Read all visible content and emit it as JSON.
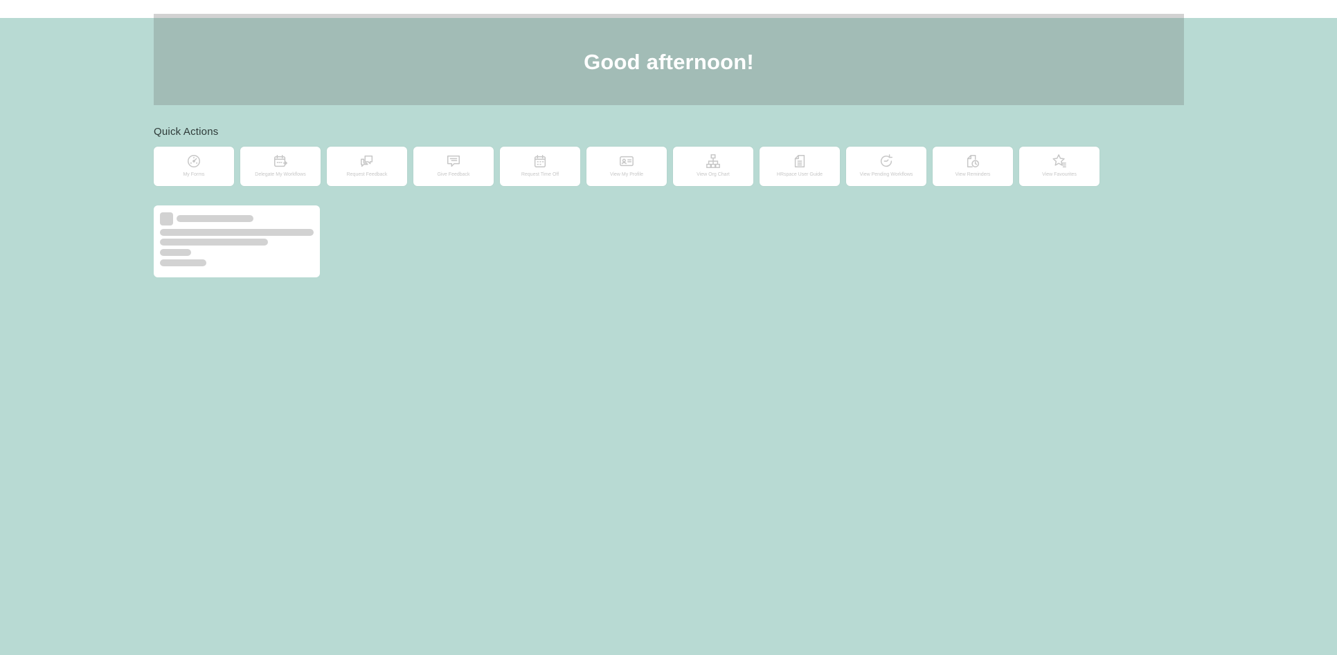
{
  "hero": {
    "title": "Good afternoon!"
  },
  "quick_actions": {
    "title": "Quick Actions",
    "items": [
      {
        "label": "My Forms",
        "icon": "gauge-icon"
      },
      {
        "label": "Delegate My Workflows",
        "icon": "calendar-arrow-icon"
      },
      {
        "label": "Request Feedback",
        "icon": "chat-bubbles-icon"
      },
      {
        "label": "Give Feedback",
        "icon": "chat-lines-icon"
      },
      {
        "label": "Request Time Off",
        "icon": "calendar-icon"
      },
      {
        "label": "View My Profile",
        "icon": "id-card-icon"
      },
      {
        "label": "View Org Chart",
        "icon": "org-chart-icon"
      },
      {
        "label": "HRspace User Guide",
        "icon": "document-icon"
      },
      {
        "label": "View Pending Workflows",
        "icon": "refresh-icon"
      },
      {
        "label": "View Reminders",
        "icon": "document-clock-icon"
      },
      {
        "label": "View Favourites",
        "icon": "star-list-icon"
      }
    ]
  },
  "colors": {
    "background": "#b8dad3",
    "hero": "#a2bcb6",
    "card": "#ffffff",
    "icon": "#c6c6c6",
    "skeleton": "#d2d2d2"
  }
}
